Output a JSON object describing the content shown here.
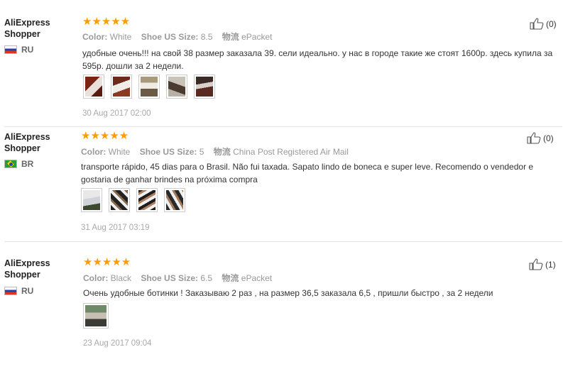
{
  "reviews": [
    {
      "user_line1": "AliExpress",
      "user_line2": "Shopper",
      "country": "RU",
      "stars": "★★★★★",
      "color_key": "Color:",
      "color_val": "White",
      "size_key": "Shoe US Size:",
      "size_val": "8.5",
      "ship_key": "物流",
      "ship_val": "ePacket",
      "text": "удобные очень!!! на свой 38 размер заказала 39. сели идеально. у нас в городе такие же стоят 1600р. здесь купила за 595р. дошли за 2 недели.",
      "date": "30 Aug 2017 02:00",
      "helpful_count": "(0)",
      "photo_count": 5
    },
    {
      "user_line1": "AliExpress",
      "user_line2": "Shopper",
      "country": "BR",
      "stars": "★★★★★",
      "color_key": "Color:",
      "color_val": "White",
      "size_key": "Shoe US Size:",
      "size_val": "5",
      "ship_key": "物流",
      "ship_val": "China Post Registered Air Mail",
      "text": "transporte rápido, 45 dias para o Brasil. Não fui taxada. Sapato lindo de boneca e super leve. Recomendo o vendedor e gostaria de ganhar brindes na próxima compra",
      "date": "31 Aug 2017 03:19",
      "helpful_count": "(0)",
      "photo_count": 4
    },
    {
      "user_line1": "AliExpress",
      "user_line2": "Shopper",
      "country": "RU",
      "stars": "★★★★★",
      "color_key": "Color:",
      "color_val": "Black",
      "size_key": "Shoe US Size:",
      "size_val": "6.5",
      "ship_key": "物流",
      "ship_val": "ePacket",
      "text": "Очень удобные ботинки ! Заказываю 2 раз , на размер 36,5 заказала 6,5 , пришли быстро , за 2 недели",
      "date": "23 Aug 2017 09:04",
      "helpful_count": "(1)",
      "photo_count": 1
    }
  ],
  "icons": {
    "helpful": "thumbs-up-icon",
    "rating": "star-icon"
  },
  "colors": {
    "star": "#ff9c00",
    "meta": "#999999",
    "text": "#333333"
  }
}
